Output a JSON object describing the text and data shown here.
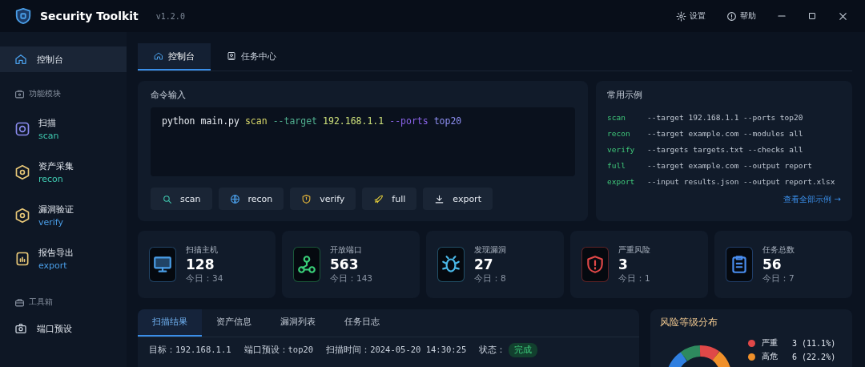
{
  "window": {
    "title": "Security Toolkit",
    "version": "v1.2.0",
    "actions": [
      "设置",
      "帮助"
    ]
  },
  "sidebar": {
    "items": [
      {
        "kind": "nav",
        "label": "控制台",
        "selected": true
      },
      {
        "kind": "section",
        "label": "功能模块"
      },
      {
        "kind": "module",
        "label": "扫描",
        "sub": "scan",
        "selected": false
      },
      {
        "kind": "module",
        "label": "资产采集",
        "sub": "recon",
        "selected": false
      },
      {
        "kind": "module",
        "label": "漏洞验证",
        "sub": "verify",
        "selected": false
      },
      {
        "kind": "module",
        "label": "报告导出",
        "sub": "export",
        "selected": false
      },
      {
        "kind": "section",
        "label": "工具箱"
      },
      {
        "kind": "nav",
        "label": "端口预设",
        "selected": false
      }
    ]
  },
  "tabs": [
    {
      "label": "控制台",
      "selected": true
    },
    {
      "label": "任务中心",
      "selected": false
    }
  ],
  "command": {
    "title": "命令输入",
    "tokens": [
      {
        "text": "python main.py",
        "kind": "program"
      },
      {
        "text": "scan",
        "kind": "subcommand"
      },
      {
        "text": "--target",
        "kind": "flag"
      },
      {
        "text": "192.168.1.1",
        "kind": "value"
      },
      {
        "text": "--ports",
        "kind": "option"
      },
      {
        "text": "top20",
        "kind": "option_value"
      }
    ],
    "buttons": [
      "scan",
      "recon",
      "verify",
      "full",
      "export"
    ]
  },
  "examples": {
    "title": "常用示例",
    "rows": [
      {
        "command": "scan",
        "args": "--target 192.168.1.1 --ports top20"
      },
      {
        "command": "recon",
        "args": "--target example.com --modules all"
      },
      {
        "command": "verify",
        "args": "--targets targets.txt --checks all"
      },
      {
        "command": "full",
        "args": "--target example.com --output report"
      },
      {
        "command": "export",
        "args": "--input results.json --output report.xlsx"
      }
    ],
    "link": "查看全部示例 →"
  },
  "stats": [
    {
      "label": "扫描主机",
      "value": "128",
      "today": "今日：34"
    },
    {
      "label": "开放端口",
      "value": "563",
      "today": "今日：143"
    },
    {
      "label": "发现漏洞",
      "value": "27",
      "today": "今日：8"
    },
    {
      "label": "严重风险",
      "value": "3",
      "today": "今日：1"
    },
    {
      "label": "任务总数",
      "value": "56",
      "today": "今日：7"
    }
  ],
  "results": {
    "tabs": [
      {
        "label": "扫描结果",
        "selected": true
      },
      {
        "label": "资产信息",
        "selected": false
      },
      {
        "label": "漏洞列表",
        "selected": false
      },
      {
        "label": "任务日志",
        "selected": false
      }
    ],
    "fields": [
      "目标：192.168.1.1",
      "端口预设：top20",
      "扫描时间：2024-05-20 14:30:25"
    ],
    "status_label": "状态：",
    "status": "完成"
  },
  "risk": {
    "title": "风险等级分布",
    "legend": [
      {
        "label": "严重",
        "value": "3 (11.1%)",
        "color": "#e04848"
      },
      {
        "label": "高危",
        "value": "6 (22.2%)",
        "color": "#f0902a"
      }
    ]
  }
}
